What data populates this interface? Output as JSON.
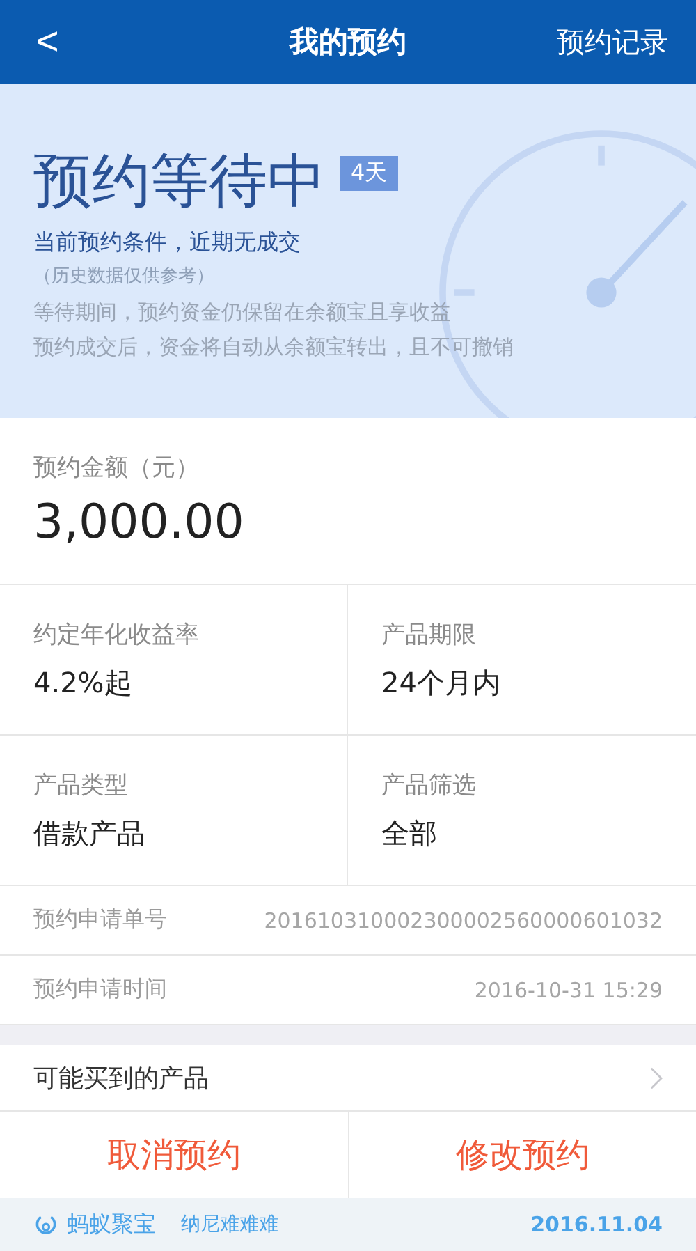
{
  "nav_bar": {
    "back": "<",
    "title": "我的预约",
    "action": "预约记录"
  },
  "status_card": {
    "title": "预约等待中",
    "badge": "4天",
    "headline": "当前预约条件，近期无成交",
    "note": "（历史数据仅供参考）",
    "details": [
      "等待期间，预约资金仍保留在余额宝且享收益",
      "预约成交后，资金将自动从余额宝转出，且不可撤销"
    ]
  },
  "amount": {
    "label": "预约金额（元）",
    "value": "3,000.00"
  },
  "info_grid": [
    {
      "label": "约定年化收益率",
      "value": "4.2%起"
    },
    {
      "label": "产品期限",
      "value": "24个月内"
    },
    {
      "label": "产品类型",
      "value": "借款产品"
    },
    {
      "label": "产品筛选",
      "value": "全部"
    }
  ],
  "info_rows": [
    {
      "label": "预约申请单号",
      "value": "201610310002300002560000601032"
    },
    {
      "label": "预约申请时间",
      "value": "2016-10-31 15:29"
    }
  ],
  "products_link": {
    "label": "可能买到的产品"
  },
  "buttons": [
    {
      "label": "取消预约"
    },
    {
      "label": "修改预约"
    }
  ],
  "footer": {
    "brand": "蚂蚁聚宝",
    "user": "纳尼难难难",
    "date": "2016.11.04"
  }
}
